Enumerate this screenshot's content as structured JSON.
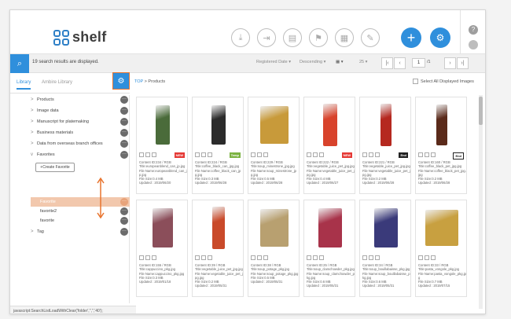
{
  "app": {
    "name": "shelf"
  },
  "toolbar": {
    "icons": [
      "download-icon",
      "share-icon",
      "document-icon",
      "flag-icon",
      "calendar-icon",
      "edit-icon"
    ],
    "add_label": "+",
    "help_label": "?"
  },
  "searchbar": {
    "results_text": "19 search results are displayed.",
    "sort_field": "Registered Date",
    "sort_order": "Descending",
    "per_page": "25",
    "page": "1",
    "page_total": "/1"
  },
  "tabs": [
    {
      "label": "Library"
    },
    {
      "label": "Ambire Library"
    }
  ],
  "breadcrumb": {
    "root": "TOP",
    "sep": ">",
    "current": "Products"
  },
  "select_all_label": "Select All Displayed Images",
  "sidebar": {
    "items": [
      {
        "label": "Products",
        "chev": ">"
      },
      {
        "label": "Image data",
        "chev": ">"
      },
      {
        "label": "Manuscript for platemaking",
        "chev": ">"
      },
      {
        "label": "Business materials",
        "chev": ">"
      },
      {
        "label": "Data from overseas branch offices",
        "chev": ">"
      },
      {
        "label": "Favorites",
        "chev": "v"
      }
    ],
    "create_favorite": "Create Favorite",
    "favorites": [
      {
        "label": "Favorite"
      },
      {
        "label": "favorite2"
      },
      {
        "label": "favorite"
      }
    ],
    "tag_label": "Tag"
  },
  "status_text": "javascript:SearchListLoadWithClear('folder','','','40');",
  "cards": [
    {
      "badge": "NEW",
      "badge_color": "#e53935",
      "lines": [
        "Content ID:234 / RGB",
        "Title:europeanblend_can_jp.jpg",
        "File Name:europeanblend_can_jp.jpg",
        "File Size:0.4 MB",
        "Updated : 2019/06/20"
      ],
      "color": "#4a6b3a"
    },
    {
      "badge": "Temp",
      "badge_color": "#7cb342",
      "lines": [
        "Content ID:224 / RGB",
        "Title:coffee_black_can_jpg.jpg",
        "File Name:coffee_black_can_jpg.jpg",
        "File Size:0.3 MB",
        "Updated : 2019/06/28"
      ],
      "color": "#2b2b2b"
    },
    {
      "badge": "",
      "badge_color": "#fff",
      "lines": [
        "Content ID:229 / RGB",
        "Title:soup_minestrone_jpg.jpg",
        "File Name:soup_minestrone_jpg.jpg",
        "File Size:0.5 MB",
        "Updated : 2019/06/28"
      ],
      "color": "#c89a3a"
    },
    {
      "badge": "NEW",
      "badge_color": "#e53935",
      "lines": [
        "Content ID:222 / RGB",
        "Title:vegetable_juice_pet_jpg.jpg",
        "File Name:vegetable_juice_pet_jpg.jpg",
        "File Size:0.4 MB",
        "Updated : 2019/06/27"
      ],
      "color": "#d8432c"
    },
    {
      "badge": "End",
      "badge_color": "#222",
      "lines": [
        "Content ID:221 / RGB",
        "Title:vegetable_juice_pet_jpg.jpg",
        "File Name:vegetable_juice_pet_jpg.jpg",
        "File Size:0.2 MB",
        "Updated : 2019/06/28"
      ],
      "color": "#b5281f"
    },
    {
      "badge": "End",
      "badge_color": "#fff",
      "lines": [
        "Content ID:160 / RGB",
        "Title:coffee_black_pet_jpg.jpg",
        "File Name:coffee_black_pet_jpg.jpg",
        "File Size:0.2 MB",
        "Updated : 2019/06/28"
      ],
      "color": "#5a2a1a"
    },
    {
      "badge": "",
      "badge_color": "#fff",
      "lines": [
        "Content ID:155 / RGB",
        "Title:cappuccino_pkg.jpg",
        "File Name:cappuccino_pkg.jpg",
        "File Size:0.3 MB",
        "Updated : 2019/01/18"
      ],
      "color": "#8b4e5a"
    },
    {
      "badge": "",
      "badge_color": "#fff",
      "lines": [
        "Content ID:39 / RGB",
        "Title:vegetable_juice_pet_jpg.jpg",
        "File Name:vegetable_juice_pet_jpg.jpg",
        "File Size:0.2 MB",
        "Updated : 2019/05/31"
      ],
      "color": "#c94a2a"
    },
    {
      "badge": "",
      "badge_color": "#fff",
      "lines": [
        "Content ID:38 / RGB",
        "Title:soup_potage_pkg.jpg",
        "File Name:soup_potage_pkg.jpg",
        "File Size:0.5 MB",
        "Updated : 2019/05/31"
      ],
      "color": "#b8a070"
    },
    {
      "badge": "",
      "badge_color": "#fff",
      "lines": [
        "Content ID:25 / RGB",
        "Title:soup_clamchowder_pkg.jpg",
        "File Name:soup_clamchowder_pkg.jpg",
        "File Size:0.6 MB",
        "Updated : 2019/05/31"
      ],
      "color": "#a8334a"
    },
    {
      "badge": "",
      "badge_color": "#fff",
      "lines": [
        "Content ID:34 / RGB",
        "Title:soup_bouillabaisse_pkg.jpg",
        "File Name:soup_bouillabaisse_pkg.jpg",
        "File Size:0.6 MB",
        "Updated : 2019/05/31"
      ],
      "color": "#3a3a7a"
    },
    {
      "badge": "",
      "badge_color": "#fff",
      "lines": [
        "Content ID:33 / RGB",
        "Title:pasta_vongole_pkg.jpg",
        "File Name:pasta_vongole_pkg.jpg",
        "File Size:0.7 MB",
        "Updated : 2019/07/15"
      ],
      "color": "#c8a040"
    }
  ]
}
